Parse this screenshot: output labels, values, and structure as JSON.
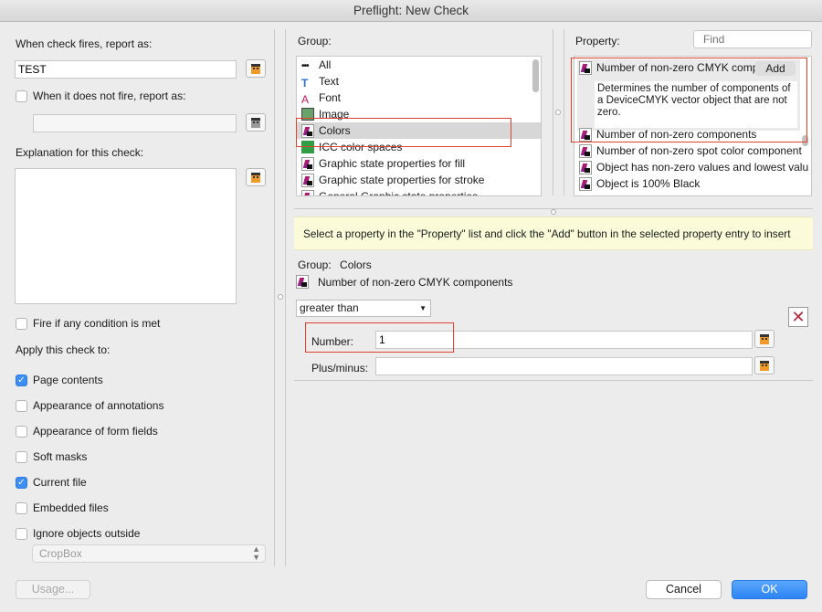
{
  "window": {
    "title": "Preflight: New Check"
  },
  "left": {
    "report_label": "When check fires, report as:",
    "report_value": "TEST",
    "not_fire_label": "When it does not fire, report as:",
    "not_fire_value": "",
    "explanation_label": "Explanation for this check:",
    "explanation_value": "",
    "fire_any_label": "Fire if any condition is met",
    "apply_label": "Apply this check to:",
    "apply_items": [
      {
        "label": "Page contents",
        "checked": true
      },
      {
        "label": "Appearance of annotations",
        "checked": false
      },
      {
        "label": "Appearance of form fields",
        "checked": false
      },
      {
        "label": "Soft masks",
        "checked": false
      },
      {
        "label": "Current file",
        "checked": true
      },
      {
        "label": "Embedded files",
        "checked": false
      },
      {
        "label": "Ignore objects outside",
        "checked": false
      }
    ],
    "cropbox_value": "CropBox",
    "usage_label": "Usage..."
  },
  "group": {
    "label": "Group:",
    "items": [
      {
        "label": "All",
        "icon": "all-icon"
      },
      {
        "label": "Text",
        "icon": "text-icon"
      },
      {
        "label": "Font",
        "icon": "font-icon"
      },
      {
        "label": "Image",
        "icon": "image-icon"
      },
      {
        "label": "Colors",
        "icon": "colors-icon",
        "selected": true
      },
      {
        "label": "ICC color spaces",
        "icon": "icc-icon"
      },
      {
        "label": "Graphic state properties for fill",
        "icon": "graphic-state-icon"
      },
      {
        "label": "Graphic state properties for stroke",
        "icon": "graphic-state-icon"
      },
      {
        "label": "General Graphic state properties",
        "icon": "graphic-state-icon"
      }
    ]
  },
  "property": {
    "label": "Property:",
    "find_placeholder": "Find",
    "selected_title": "Number of non-zero CMYK compo",
    "add_label": "Add",
    "description": "Determines the number of components of a DeviceCMYK vector object that are not zero.",
    "items": [
      "Number of non-zero components",
      "Number of non-zero spot color component",
      "Object has non-zero values and lowest valu",
      "Object is 100% Black"
    ]
  },
  "hint": "Select a property in the \"Property\" list and click the \"Add\" button in the selected property entry to insert",
  "condition": {
    "group_label": "Group:",
    "group_value": "Colors",
    "property_name": "Number of non-zero CMYK components",
    "operator": "greater than",
    "number_label": "Number:",
    "number_value": "1",
    "plusminus_label": "Plus/minus:",
    "plusminus_value": ""
  },
  "footer": {
    "cancel": "Cancel",
    "ok": "OK"
  },
  "colors": {
    "accent": "#3d8ef7",
    "highlight_border": "#e2412f",
    "hint_bg": "#fbfbd9"
  }
}
